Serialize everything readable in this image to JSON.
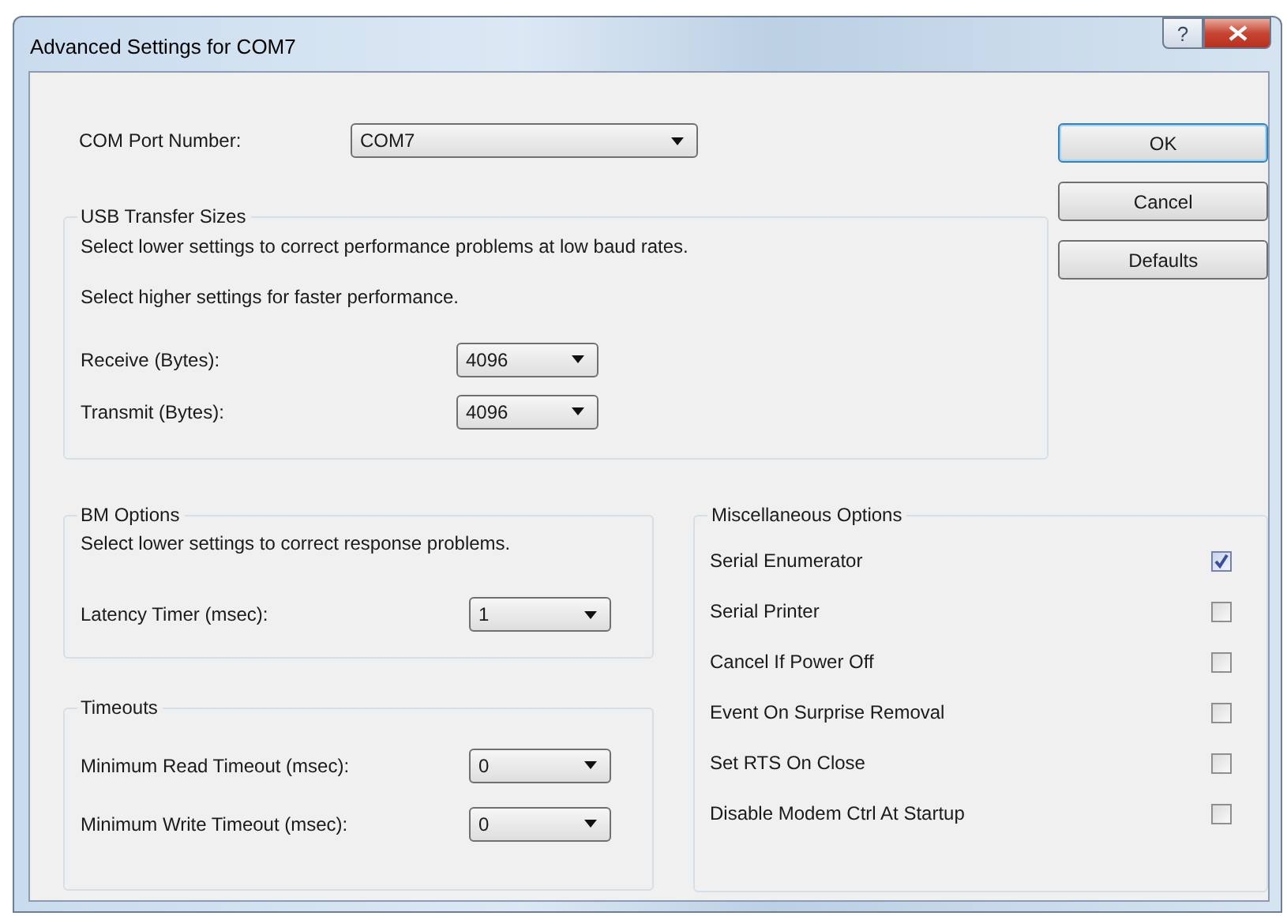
{
  "window": {
    "title": "Advanced Settings for COM7",
    "help_label": "?"
  },
  "com_port": {
    "label": "COM Port Number:",
    "value": "COM7"
  },
  "buttons": [
    {
      "label": "OK",
      "default": true
    },
    {
      "label": "Cancel",
      "default": false
    },
    {
      "label": "Defaults",
      "default": false
    }
  ],
  "usb_transfer": {
    "title": "USB Transfer Sizes",
    "notes": [
      "Select lower settings to correct performance problems at low baud rates.",
      "Select higher settings for faster performance."
    ],
    "fields": [
      {
        "label": "Receive (Bytes):",
        "value": "4096"
      },
      {
        "label": "Transmit (Bytes):",
        "value": "4096"
      }
    ]
  },
  "bm_options": {
    "title": "BM Options",
    "note": "Select lower settings to correct response problems.",
    "fields": [
      {
        "label": "Latency Timer (msec):",
        "value": "1"
      }
    ]
  },
  "timeouts": {
    "title": "Timeouts",
    "fields": [
      {
        "label": "Minimum Read Timeout (msec):",
        "value": "0"
      },
      {
        "label": "Minimum Write Timeout (msec):",
        "value": "0"
      }
    ]
  },
  "misc_options": {
    "title": "Miscellaneous Options",
    "items": [
      {
        "label": "Serial Enumerator",
        "checked": true
      },
      {
        "label": "Serial Printer",
        "checked": false
      },
      {
        "label": "Cancel If Power Off",
        "checked": false
      },
      {
        "label": "Event On Surprise Removal",
        "checked": false
      },
      {
        "label": "Set RTS On Close",
        "checked": false
      },
      {
        "label": "Disable Modem Ctrl At Startup",
        "checked": false
      }
    ]
  }
}
